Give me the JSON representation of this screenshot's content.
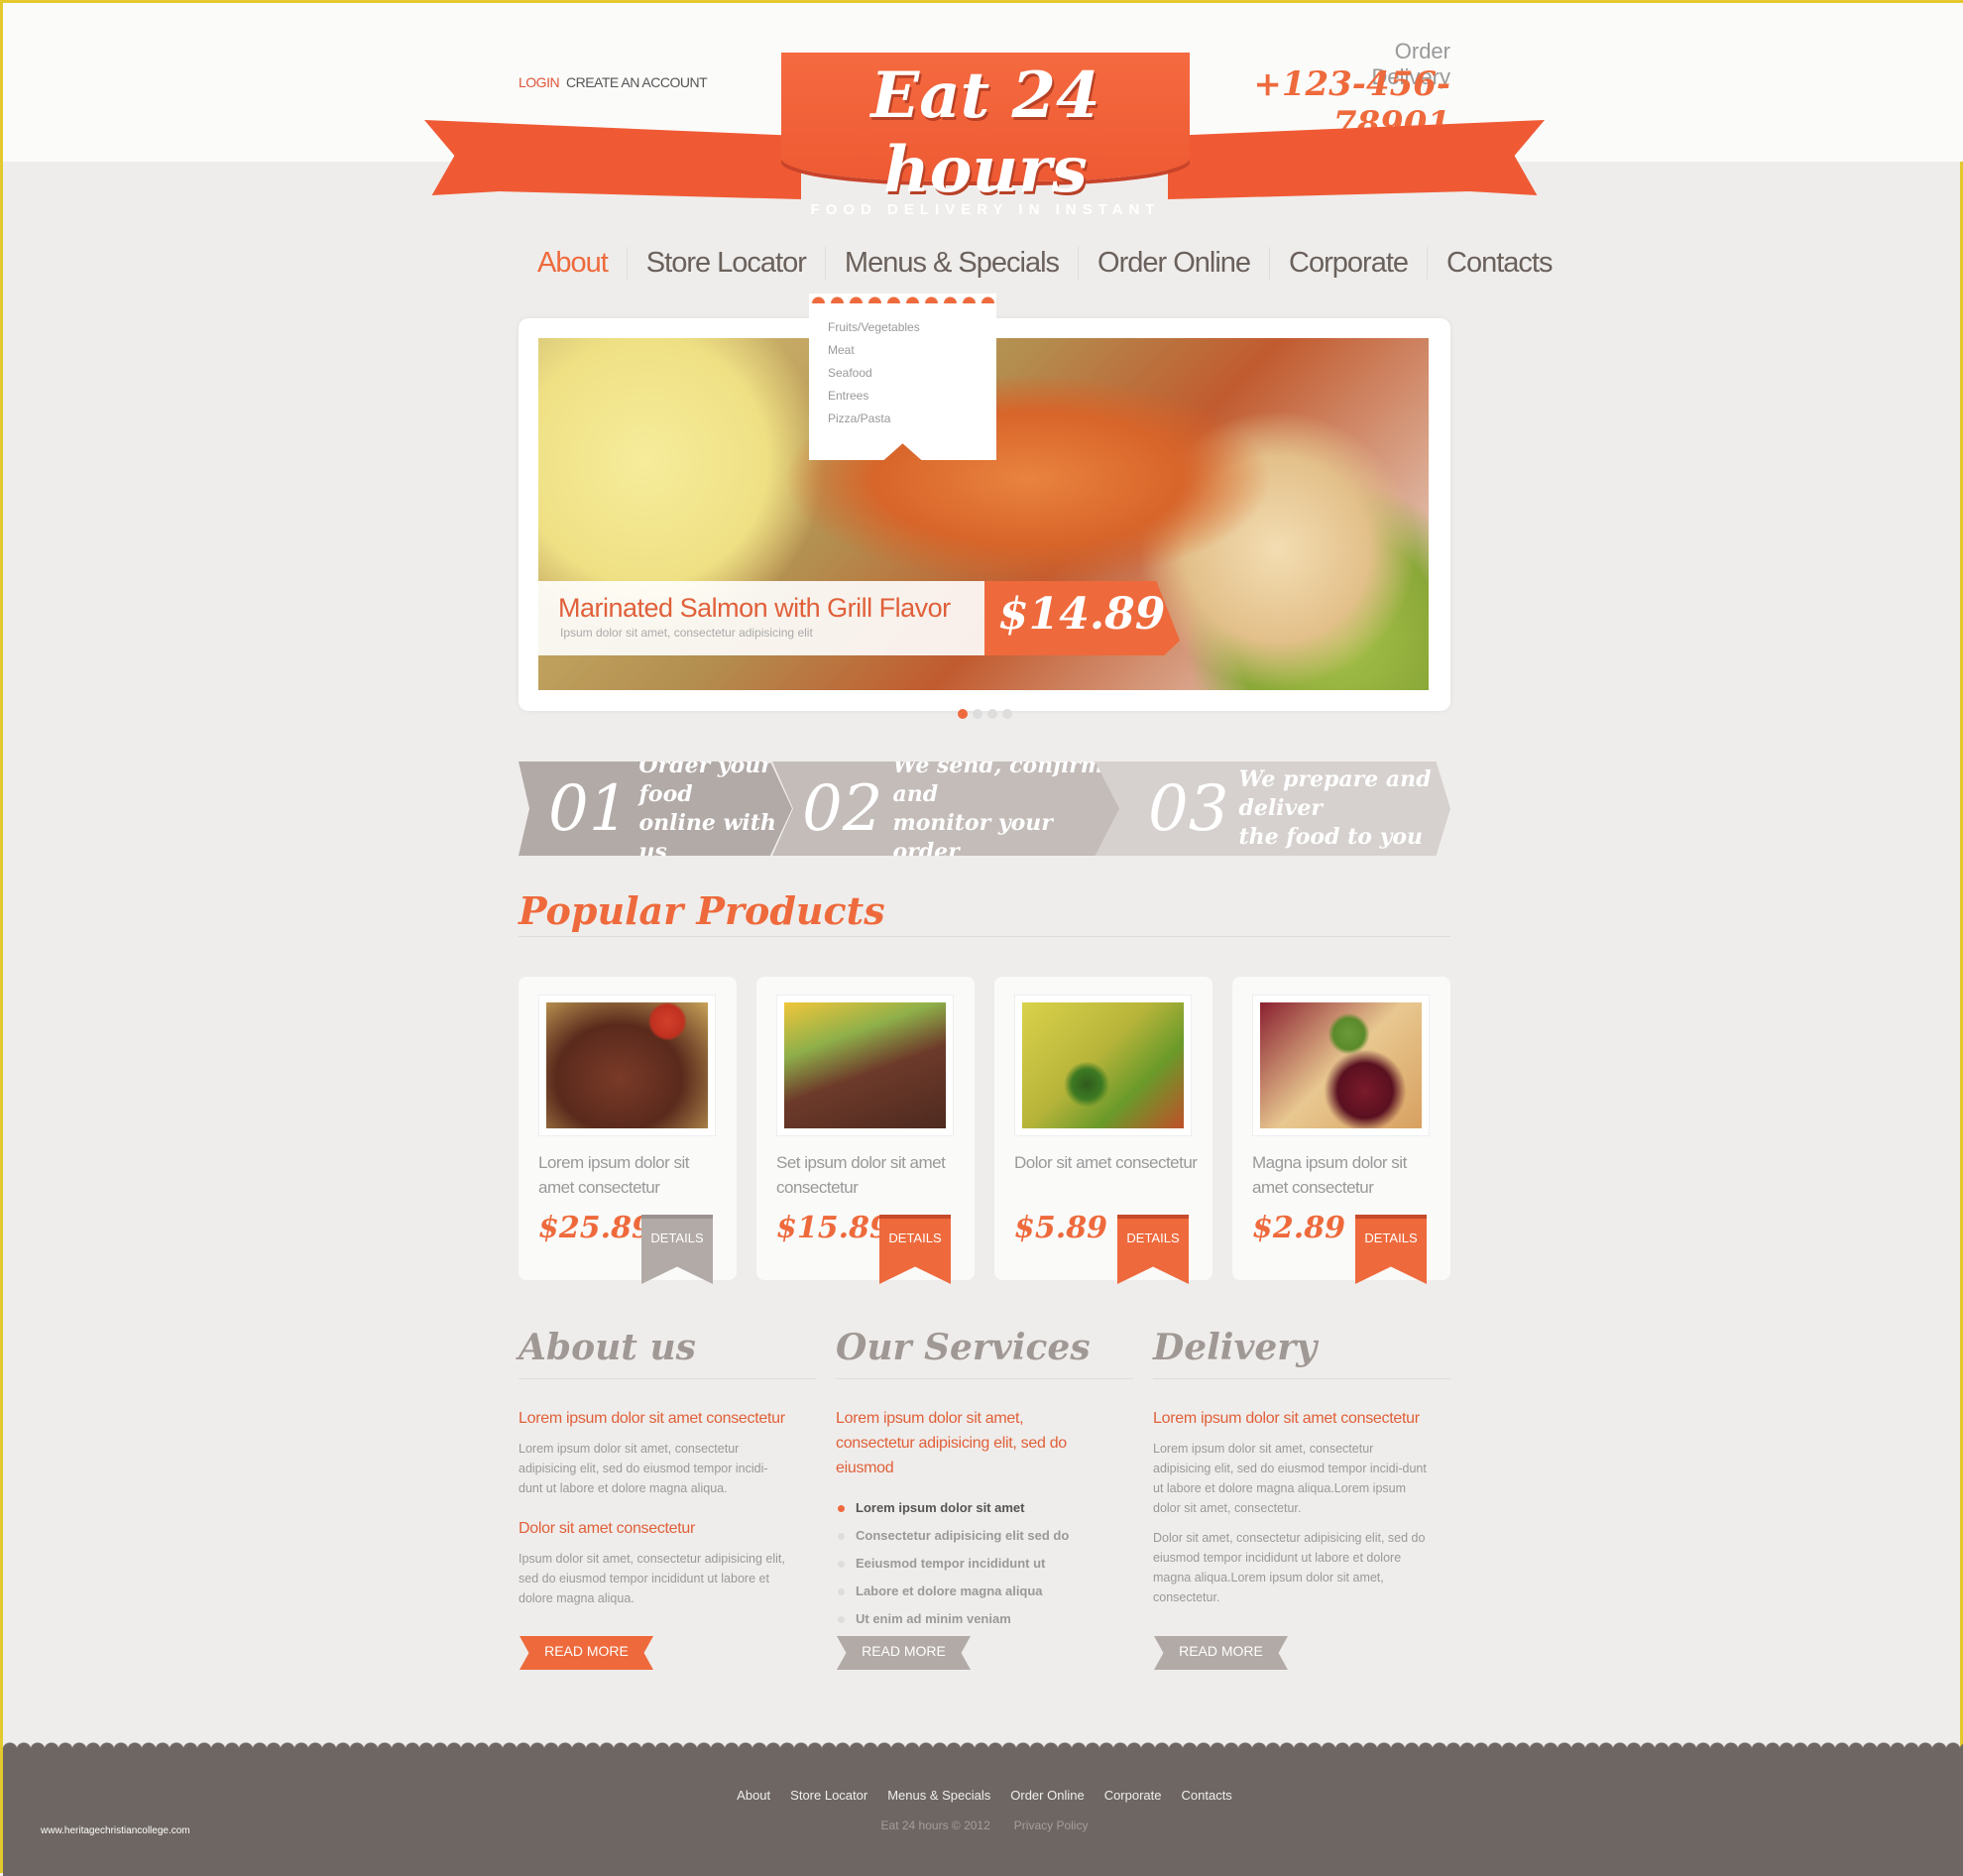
{
  "header": {
    "login": "LOGIN",
    "create_account": "CREATE AN ACCOUNT",
    "order_label": "Order Delivery",
    "phone": "+123-456-78901",
    "logo_title": "Eat 24 hours",
    "logo_tagline": "FOOD DELIVERY IN INSTANT"
  },
  "nav": {
    "items": [
      "About",
      "Store Locator",
      "Menus & Specials",
      "Order Online",
      "Corporate",
      "Contacts"
    ],
    "active": "About"
  },
  "dropdown": {
    "items": [
      "Fruits/Vegetables",
      "Meat",
      "Seafood",
      "Entrees",
      "Pizza/Pasta"
    ]
  },
  "slider": {
    "title": "Marinated Salmon with Grill Flavor",
    "subtitle": "Ipsum dolor sit amet, consectetur adipisicing elit",
    "price": "$14.89",
    "slides": 4,
    "active_slide": 1
  },
  "steps": [
    {
      "num": "01",
      "text1": "Order your food",
      "text2": "online with us"
    },
    {
      "num": "02",
      "text1": "We send, confirm and",
      "text2": "monitor your order"
    },
    {
      "num": "03",
      "text1": "We prepare and deliver",
      "text2": "the food to you"
    }
  ],
  "popular": {
    "title": "Popular Products",
    "products": [
      {
        "name": "Lorem ipsum dolor sit amet consectetur",
        "price": "$25.89",
        "button": "DETAILS"
      },
      {
        "name": "Set ipsum dolor sit amet consectetur",
        "price": "$15.89",
        "button": "DETAILS"
      },
      {
        "name": "Dolor sit amet consectetur",
        "price": "$5.89",
        "button": "DETAILS"
      },
      {
        "name": "Magna ipsum dolor sit amet consectetur",
        "price": "$2.89",
        "button": "DETAILS"
      }
    ]
  },
  "about": {
    "title": "About us",
    "h1": "Lorem ipsum dolor sit amet consectetur",
    "p1": "Lorem ipsum dolor sit amet, consectetur adipisicing elit, sed do eiusmod tempor incidi-dunt ut labore et dolore magna aliqua.",
    "h2": "Dolor sit amet consectetur",
    "p2": "Ipsum dolor sit amet, consectetur adipisicing elit, sed do eiusmod tempor incididunt ut labore et dolore magna aliqua.",
    "button": "READ MORE"
  },
  "services": {
    "title": "Our Services",
    "h1": "Lorem ipsum dolor sit amet, consectetur adipisicing elit, sed do eiusmod",
    "list": [
      "Lorem ipsum dolor sit amet",
      "Consectetur adipisicing elit sed do",
      "Eeiusmod tempor incididunt ut",
      "Labore et dolore magna aliqua",
      "Ut enim ad minim veniam"
    ],
    "button": "READ MORE"
  },
  "delivery": {
    "title": "Delivery",
    "h1": "Lorem ipsum dolor sit amet consectetur",
    "p1": "Lorem ipsum dolor sit amet, consectetur adipisicing elit, sed do eiusmod tempor incidi-dunt ut labore et dolore magna aliqua.Lorem ipsum dolor sit amet, consectetur.",
    "p2": "Dolor sit amet, consectetur adipisicing elit, sed do eiusmod tempor incididunt ut labore et dolore magna aliqua.Lorem ipsum dolor sit amet, consectetur.",
    "button": "READ MORE"
  },
  "footer": {
    "links": [
      "About",
      "Store Locator",
      "Menus & Specials",
      "Order Online",
      "Corporate",
      "Contacts"
    ],
    "copyright": "Eat 24 hours © 2012",
    "privacy": "Privacy Policy",
    "watermark": "www.heritagechristiancollege.com"
  },
  "colors": {
    "accent": "#ee6a3c",
    "grey_ribbon": "#b2aaa7",
    "footer": "#6e6662"
  }
}
